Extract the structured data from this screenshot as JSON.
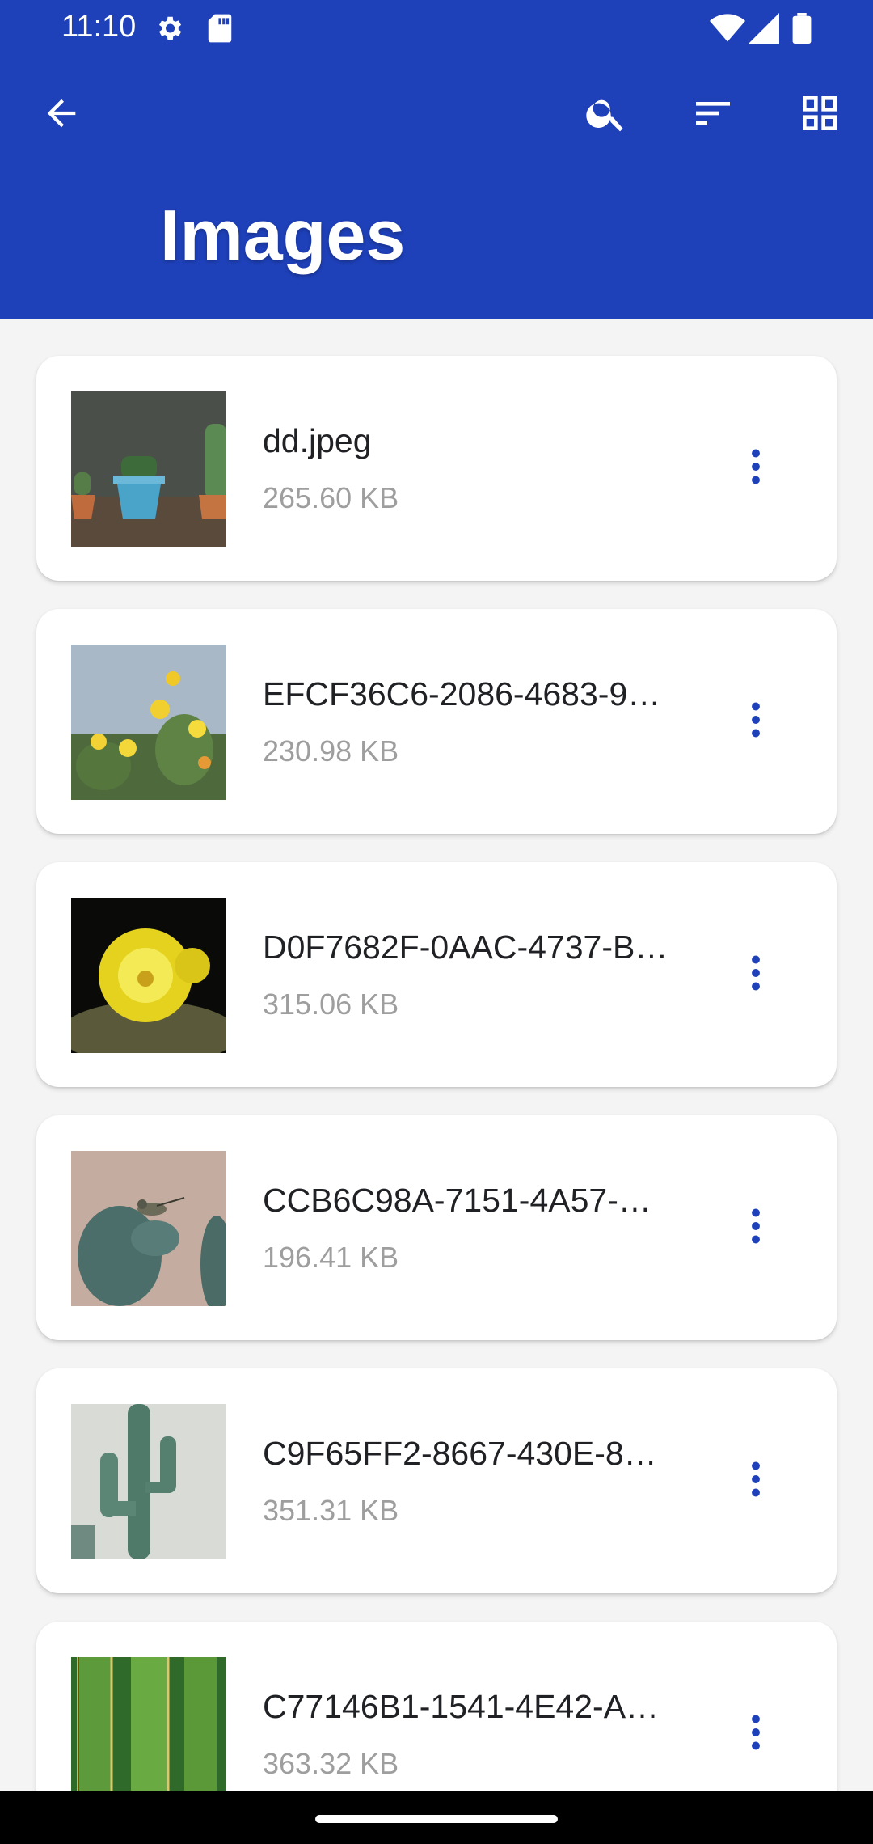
{
  "status_bar": {
    "time": "11:10",
    "left_icons": [
      "gear-icon",
      "sd-card-icon"
    ],
    "right_icons": [
      "wifi-icon",
      "cell-signal-icon",
      "battery-icon"
    ]
  },
  "app_bar": {
    "title": "Images",
    "background_color": "#1e40b8",
    "actions": [
      "back-arrow-icon",
      "search-icon",
      "sort-icon",
      "grid-view-icon"
    ]
  },
  "files": [
    {
      "name": "dd.jpeg",
      "size": "265.60 KB",
      "thumbnail": "potted-cacti-photo"
    },
    {
      "name": "EFCF36C6-2086-4683-9…",
      "size": "230.98 KB",
      "thumbnail": "flowering-prickly-pear-photo"
    },
    {
      "name": "D0F7682F-0AAC-4737-B…",
      "size": "315.06 KB",
      "thumbnail": "yellow-cactus-flower-photo"
    },
    {
      "name": "CCB6C98A-7151-4A57-…",
      "size": "196.41 KB",
      "thumbnail": "hummingbird-on-cactus-photo"
    },
    {
      "name": "C9F65FF2-8667-430E-8…",
      "size": "351.31 KB",
      "thumbnail": "tall-cactus-photo"
    },
    {
      "name": "C77146B1-1541-4E42-A…",
      "size": "363.32 KB",
      "thumbnail": "cactus-spines-closeup-photo"
    }
  ],
  "accent_color": "#1e40b8"
}
